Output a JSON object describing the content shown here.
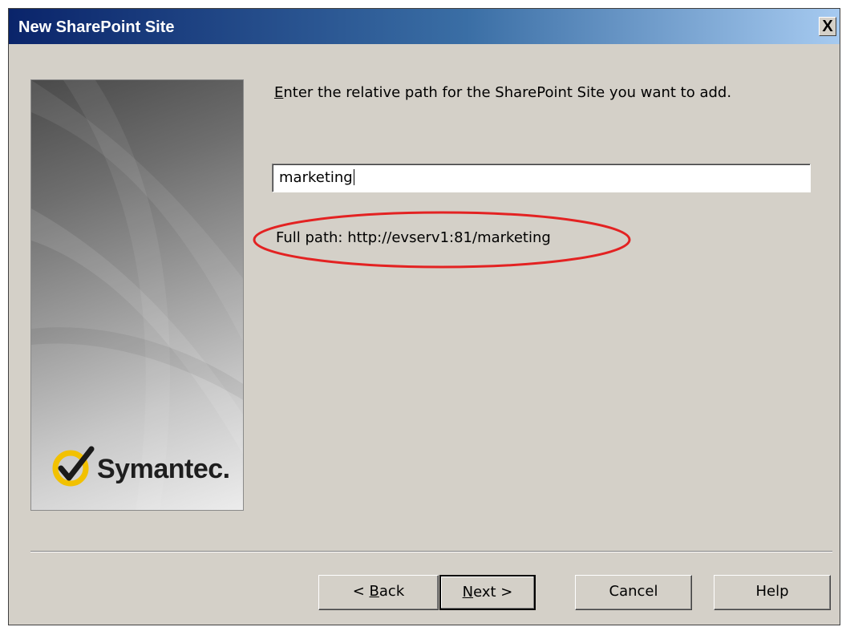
{
  "window": {
    "title": "New SharePoint Site",
    "close_label": "X"
  },
  "banner": {
    "brand_name": "Symantec.",
    "brand_color": "#f2c100"
  },
  "main": {
    "instruction_prefix": "E",
    "instruction_rest": "nter the relative path for the SharePoint Site you want to add.",
    "path_input_value": "marketing",
    "full_path_text": "Full path: http://evserv1:81/marketing",
    "highlight_color": "#e32222"
  },
  "buttons": {
    "back_prefix": "< ",
    "back_access": "B",
    "back_rest": "ack",
    "next_access": "N",
    "next_rest": "ext >",
    "cancel_label": "Cancel",
    "help_label": "Help"
  }
}
